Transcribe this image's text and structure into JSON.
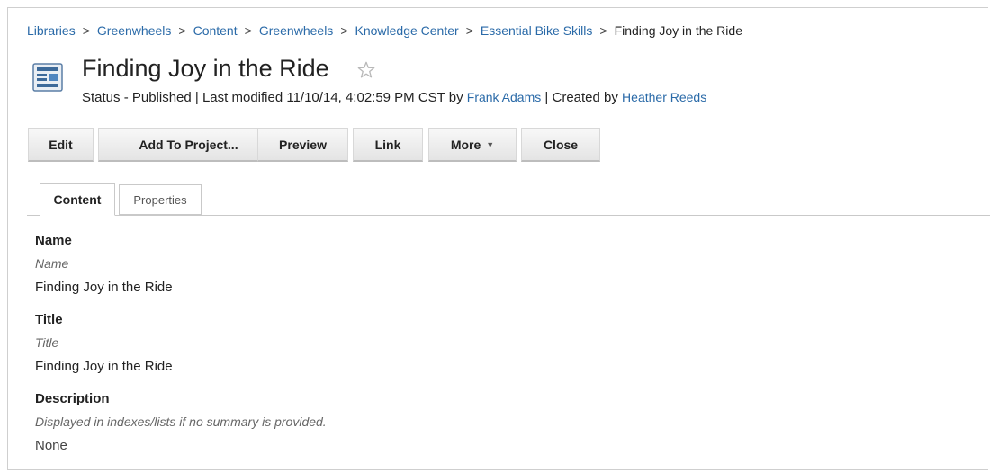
{
  "breadcrumb": {
    "items": [
      "Libraries",
      "Greenwheels",
      "Content",
      "Greenwheels",
      "Knowledge Center",
      "Essential Bike Skills"
    ],
    "separator": ">",
    "current": "Finding Joy in the Ride"
  },
  "header": {
    "title": "Finding Joy in the Ride",
    "status_prefix": "Status - Published | Last modified 11/10/14, 4:02:59 PM CST by",
    "modified_by": "Frank Adams",
    "created_prefix": "| Created by",
    "created_by": "Heather Reeds"
  },
  "toolbar": {
    "edit": "Edit",
    "add_to_project": "Add To Project...",
    "preview": "Preview",
    "link": "Link",
    "more": "More",
    "close": "Close"
  },
  "tabs": {
    "content": "Content",
    "properties": "Properties"
  },
  "fields": {
    "name": {
      "label": "Name",
      "hint": "Name",
      "value": "Finding Joy in the Ride"
    },
    "title": {
      "label": "Title",
      "hint": "Title",
      "value": "Finding Joy in the Ride"
    },
    "description": {
      "label": "Description",
      "hint": "Displayed in indexes/lists if no summary is provided.",
      "value": "None"
    }
  },
  "colors": {
    "link": "#2a6aa8",
    "icon_blue": "#3d6a9a",
    "border": "#c9c9c9"
  },
  "icons": {
    "document": "document-icon",
    "favorite": "star-outline-icon",
    "dropdown": "caret-down-icon"
  }
}
